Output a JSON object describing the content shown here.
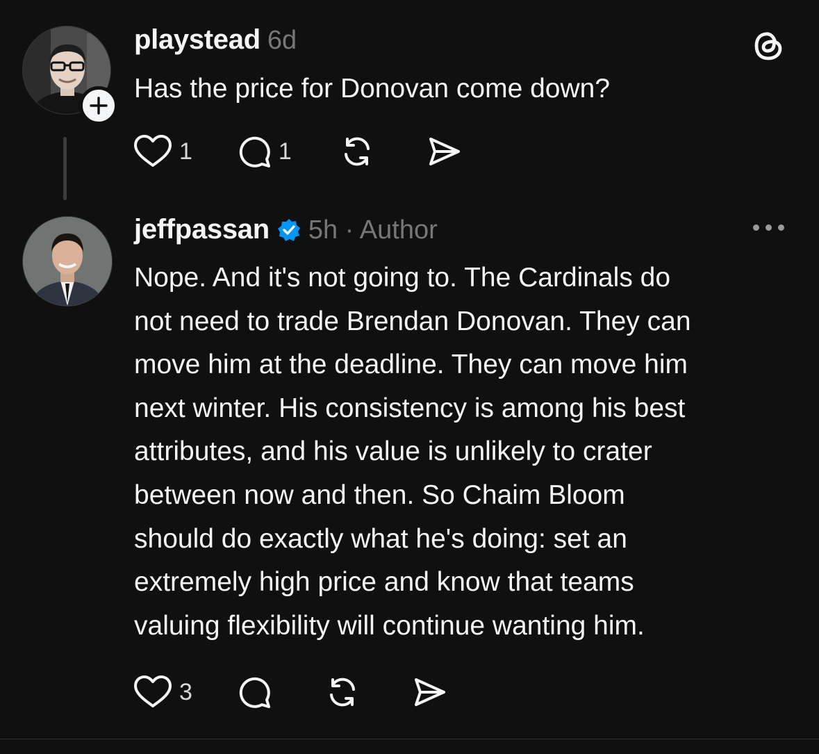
{
  "post1": {
    "username": "playstead",
    "time": "6d",
    "text": "Has the price for Donovan come down?",
    "likes": "1",
    "replies": "1",
    "avatar_icon": "person-photo-avatar",
    "follow_icon": "plus-icon"
  },
  "post2": {
    "username": "jeffpassan",
    "meta": "5h · Author",
    "verified_icon": "verified-badge-icon",
    "verified_color": "#0095f6",
    "text": "Nope. And it's not going to. The Cardinals do\nnot need to trade Brendan Donovan. They can\nmove him at the deadline. They can move him\nnext winter. His consistency is among his best\nattributes, and his value is unlikely to crater\nbetween now and then. So Chaim Bloom\nshould do exactly what he's doing: set an\nextremely high price and know that teams\nvaluing flexibility will continue wanting him.",
    "likes": "3",
    "avatar_icon": "person-photo-avatar"
  },
  "app": {
    "logo_icon": "threads-logo-icon",
    "more_icon": "more-options-icon"
  },
  "colors": {
    "background": "#101010",
    "text": "#f3f5f7",
    "secondary": "#777777"
  }
}
